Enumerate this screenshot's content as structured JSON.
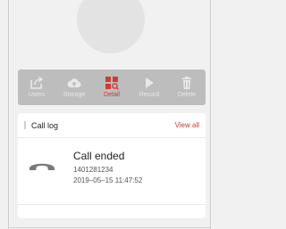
{
  "toolbar": {
    "items": [
      {
        "label": "Users",
        "icon": "share-export-icon",
        "active": false
      },
      {
        "label": "Storage",
        "icon": "cloud-upload-icon",
        "active": false
      },
      {
        "label": "Detail",
        "icon": "detail-grid-search-icon",
        "active": true
      },
      {
        "label": "Record",
        "icon": "play-icon",
        "active": false
      },
      {
        "label": "Delete",
        "icon": "trash-icon",
        "active": false
      }
    ]
  },
  "call_log": {
    "title": "Call log",
    "view_all": "View all",
    "entry": {
      "status": "Call ended",
      "number": "1401281234",
      "timestamp": "2019–05–15 11:47:52",
      "icon": "phone-handset-icon"
    }
  },
  "colors": {
    "accent": "#d23a2f",
    "toolbar_bg": "#bdbdbd",
    "page_bg": "#f1f1f1",
    "card_bg": "#ffffff"
  }
}
